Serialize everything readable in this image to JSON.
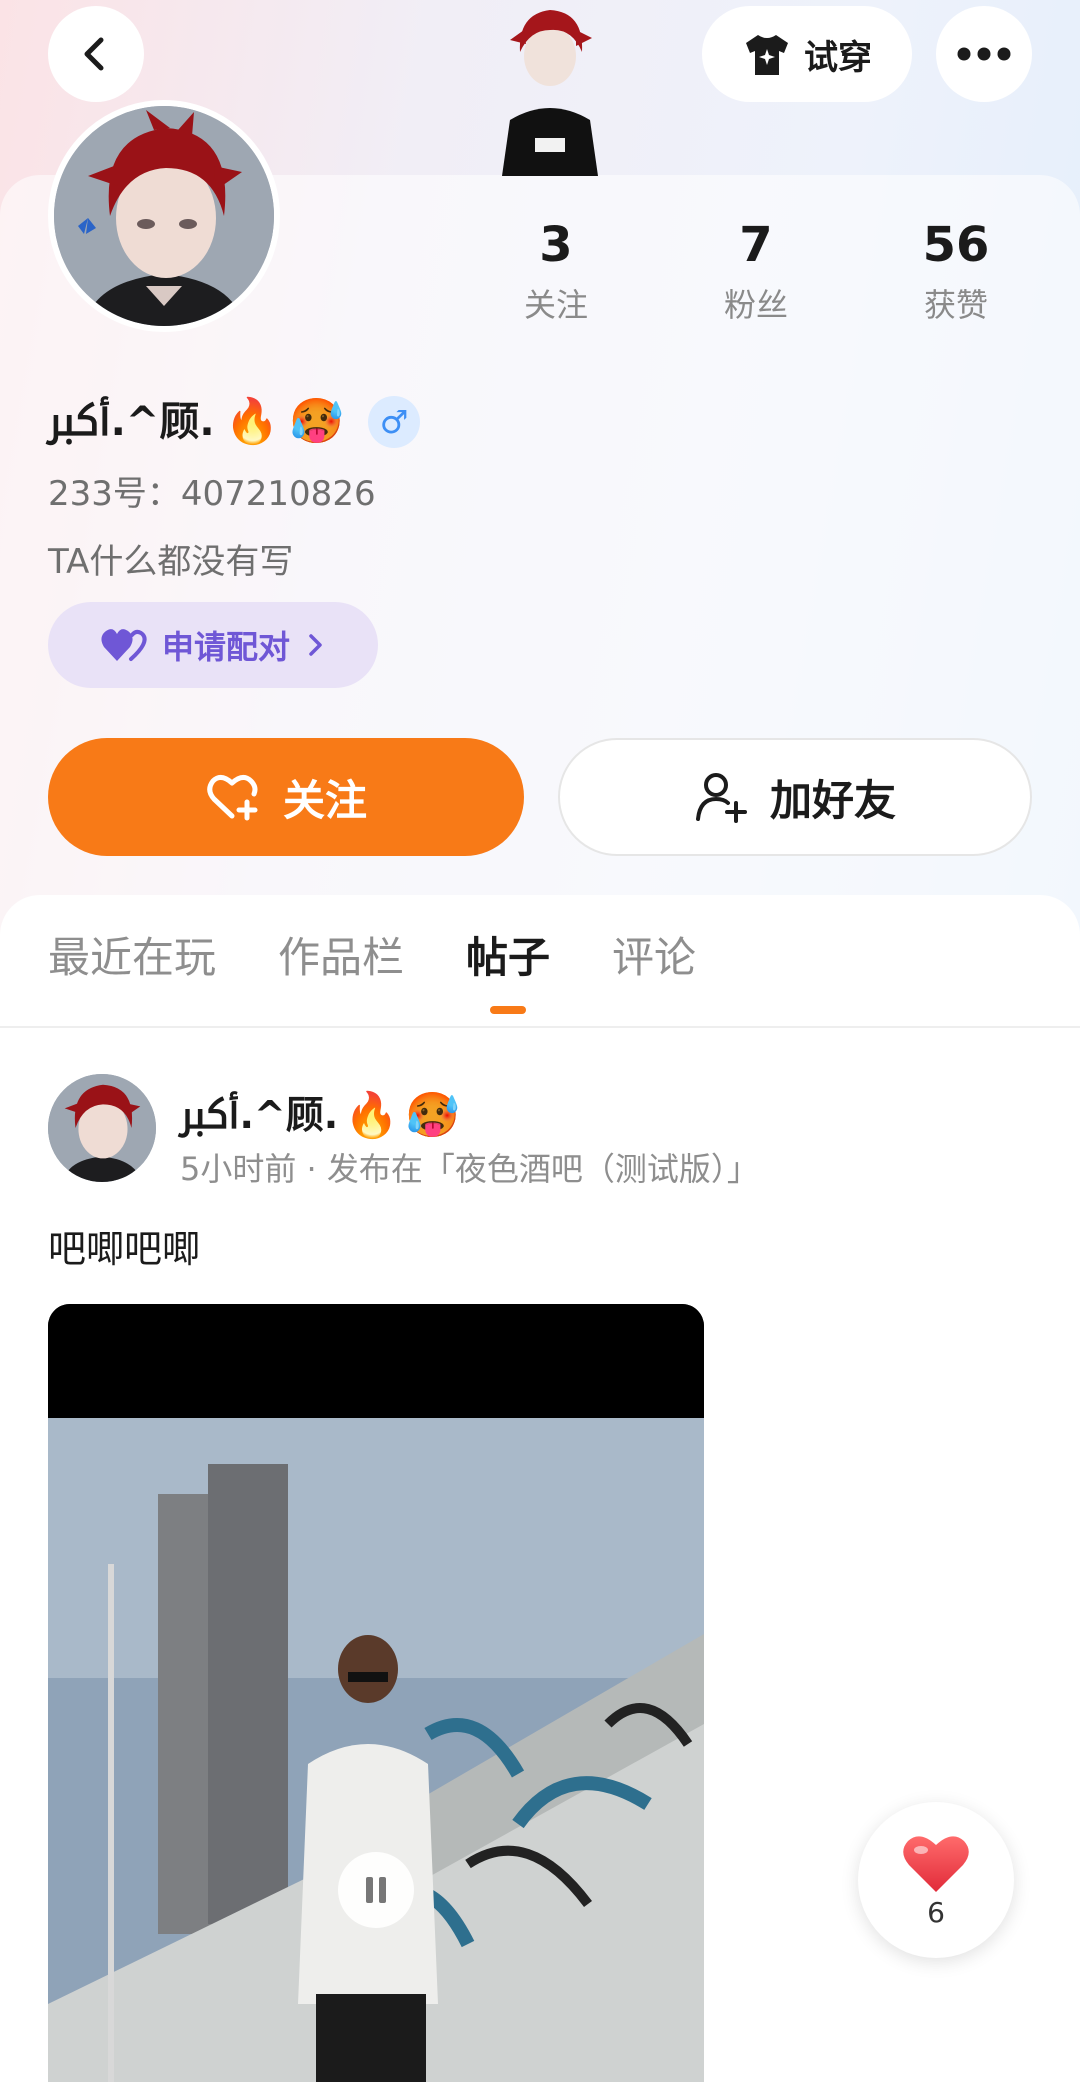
{
  "top_bar": {
    "try_on_label": "试穿",
    "icons": [
      "chevron-left-icon",
      "shirt-icon",
      "more-dots-icon"
    ]
  },
  "stats": [
    {
      "value": "3",
      "label": "关注"
    },
    {
      "value": "7",
      "label": "粉丝"
    },
    {
      "value": "56",
      "label": "获赞"
    }
  ],
  "profile": {
    "nickname": "ﷳ.^顾.",
    "emojis": [
      "🔥",
      "🥵"
    ],
    "gender_symbol": "♂",
    "uid_text": "233号：407210826",
    "bio": "TA什么都没有写",
    "pair_label": "申请配对"
  },
  "actions": {
    "follow_label": "关注",
    "add_friend_label": "加好友"
  },
  "tabs": [
    {
      "label": "最近在玩",
      "active": false
    },
    {
      "label": "作品栏",
      "active": false
    },
    {
      "label": "帖子",
      "active": true
    },
    {
      "label": "评论",
      "active": false
    }
  ],
  "post": {
    "author": "ﷳ.^顾.",
    "emojis": [
      "🔥",
      "🥵"
    ],
    "meta": "5小时前 · 发布在「夜色酒吧（测试版）」",
    "text": "吧唧吧唧",
    "like_count": "6"
  },
  "colors": {
    "accent_orange": "#f87a17",
    "pair_purple": "#6f57d6",
    "like_red": "#f0433f"
  }
}
